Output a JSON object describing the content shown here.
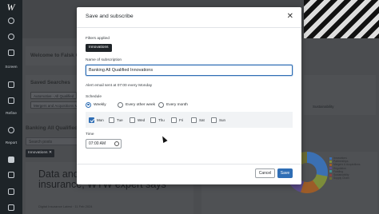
{
  "rail": {
    "logo": "W",
    "items": [
      {
        "icon": "home-icon",
        "label": ""
      },
      {
        "icon": "search-icon",
        "label": ""
      },
      {
        "icon": "grid-icon",
        "label": ""
      },
      {
        "icon": "screen-icon",
        "label": "Screen"
      },
      {
        "icon": "refine-icon",
        "label": "Refine"
      },
      {
        "icon": "report-icon",
        "label": "Report"
      }
    ]
  },
  "background": {
    "welcome": "Welcome to Falsk Cr",
    "saved_searches_title": "Saved Searches",
    "saved_chip_1": "Automotive - All Qualified",
    "saved_chip_2": "Mergers and Acquisitions M",
    "sustainability_chip": "Sustainability",
    "section_title": "Banking All Qualified",
    "search_placeholder": "Search posts",
    "tag": "Innovations",
    "headline": "Data and G cybersecurity for insurance, WTW expert says",
    "meta": "Digital Insurance Latest · 11 Feb 2024",
    "legend": [
      {
        "label": "Innovations",
        "color": "#3b70b3"
      },
      {
        "label": "Partnerships",
        "color": "#7c8c3a"
      },
      {
        "label": "Mergers & Acquisitions",
        "color": "#9c5c28"
      },
      {
        "label": "Regulation",
        "color": "#5a4b8a"
      },
      {
        "label": "Funding",
        "color": "#3f8c8e"
      },
      {
        "label": "Sustainability",
        "color": "#8a3f3f"
      },
      {
        "label": "Supply Chain",
        "color": "#6b6b33"
      }
    ]
  },
  "modal": {
    "title": "Save and subscribe",
    "filters_label": "Filters applied",
    "filter_chip": "Innovations",
    "name_label": "Name of subscription",
    "name_value": "Banking All Qualified Innovations",
    "alert_text": "Alert email sent at 07:00 every Monday",
    "schedule_label": "Schedule",
    "schedule_options": [
      {
        "label": "Weekly",
        "selected": true
      },
      {
        "label": "Every other week",
        "selected": false
      },
      {
        "label": "Every month",
        "selected": false
      }
    ],
    "days": [
      {
        "label": "Mon",
        "checked": true
      },
      {
        "label": "Tue",
        "checked": false
      },
      {
        "label": "Wed",
        "checked": false
      },
      {
        "label": "Thu",
        "checked": false
      },
      {
        "label": "Fri",
        "checked": false
      },
      {
        "label": "Sat",
        "checked": false
      },
      {
        "label": "Sun",
        "checked": false
      }
    ],
    "time_label": "Time",
    "time_value": "07:00 AM",
    "cancel_label": "Cancel",
    "save_label": "Save"
  },
  "colors": {
    "accent": "#2f6eb5",
    "rail": "#1e2428",
    "chip_dark": "#1f2428"
  }
}
